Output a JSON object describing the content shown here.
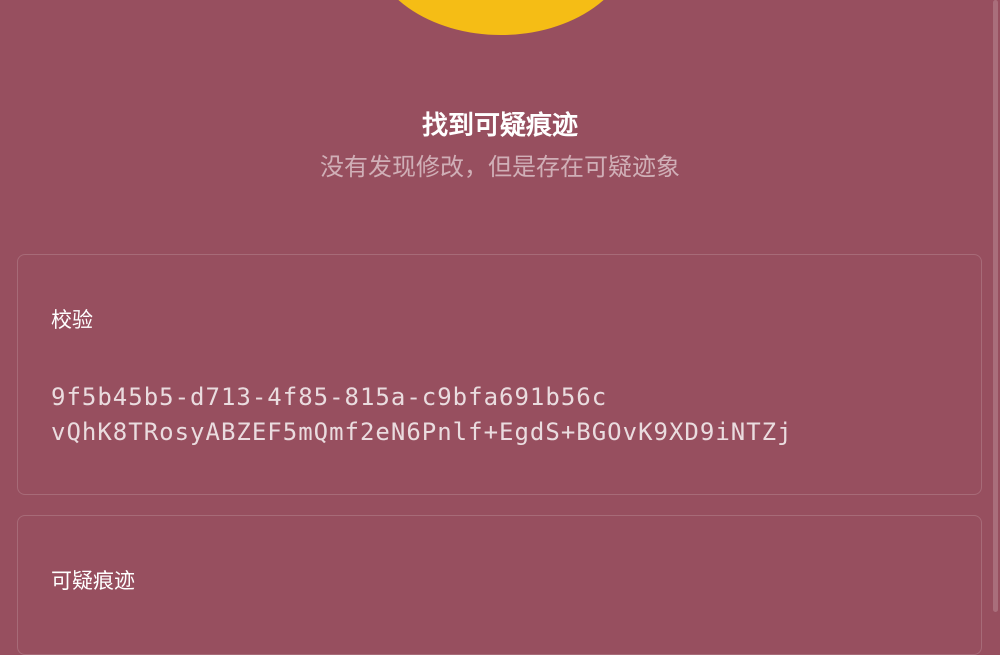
{
  "status": {
    "icon": "yellow-status-circle",
    "color": "#f5bd15",
    "title": "找到可疑痕迹",
    "subtitle": "没有发现修改，但是存在可疑迹象"
  },
  "verify_card": {
    "label": "校验",
    "lines": [
      "9f5b45b5-d713-4f85-815a-c9bfa691b56c",
      "vQhK8TRosyABZEF5mQmf2eN6Pnlf+EgdS+BGOvK9XD9iNTZj"
    ]
  },
  "traces_card": {
    "label": "可疑痕迹"
  },
  "colors": {
    "background": "#974f5f",
    "accent": "#f5bd15"
  }
}
